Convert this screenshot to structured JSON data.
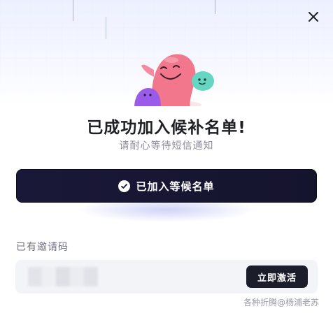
{
  "dialog": {
    "title": "已成功加入候补名单!",
    "subtitle": "请耐心等待短信通知",
    "close_icon": "close-icon"
  },
  "primary_action": {
    "label": "已加入等候名单",
    "icon": "check-circle-icon"
  },
  "invite": {
    "label": "已有邀请码",
    "input_value": "",
    "activate_label": "立即激活"
  },
  "watermark": "各种折腾@杨浦老苏",
  "colors": {
    "primary_button": "#1a1838",
    "activate_button": "#1c1d2a",
    "mascot_pink": "#f2778c",
    "mascot_teal": "#66d6c2",
    "mascot_purple": "#9a5ce8"
  }
}
